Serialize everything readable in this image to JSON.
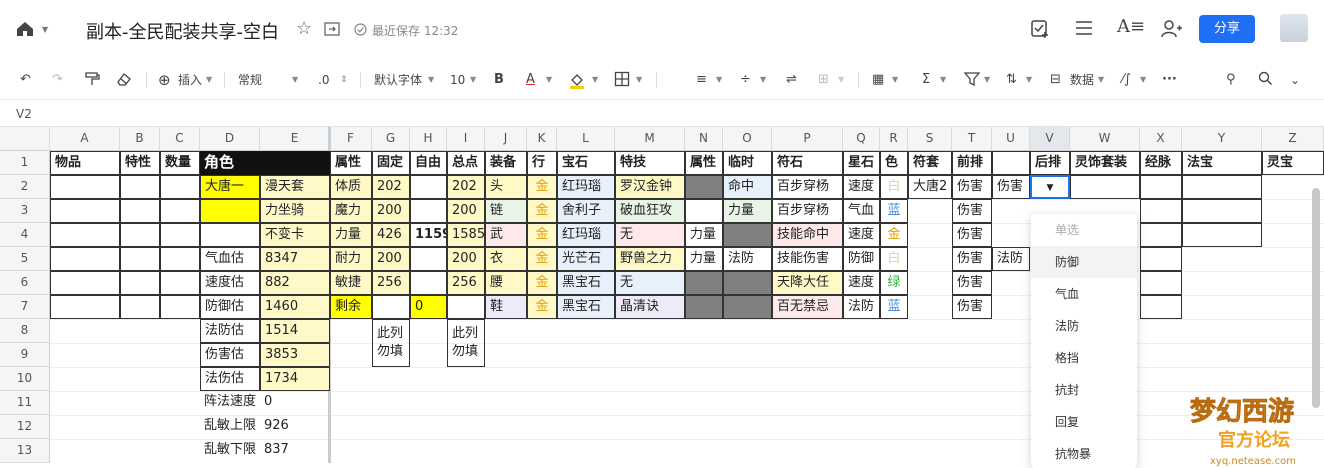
{
  "header": {
    "title": "副本-全民配装共享-空白",
    "saved_status": "最近保存 12:32",
    "share_label": "分享"
  },
  "toolbar": {
    "insert_label": "插入",
    "format_label": "常规",
    "decimal_label": ".0",
    "font_label": "默认字体",
    "size_label": "10",
    "data_label": "数据"
  },
  "name_box": "V2",
  "column_letters": [
    "A",
    "B",
    "C",
    "D",
    "E",
    "F",
    "G",
    "H",
    "I",
    "J",
    "K",
    "L",
    "M",
    "N",
    "O",
    "P",
    "Q",
    "R",
    "S",
    "T",
    "U",
    "V",
    "W",
    "X",
    "Y",
    "Z"
  ],
  "row_numbers": [
    "1",
    "2",
    "3",
    "4",
    "5",
    "6",
    "7",
    "8",
    "9",
    "10",
    "11",
    "12",
    "13"
  ],
  "headers": {
    "A": "物品",
    "B": "特性",
    "C": "数量",
    "D": "角色",
    "F": "属性",
    "G": "固定",
    "H": "自由",
    "I": "总点",
    "J": "装备",
    "K": "行",
    "L": "宝石",
    "M": "特技",
    "N": "属性",
    "O": "临时",
    "P": "符石",
    "Q": "星石",
    "R": "色",
    "S": "符套",
    "T": "前排",
    "V": "后排",
    "W": "灵饰套装",
    "X": "经脉",
    "Y": "法宝",
    "Z": "灵宝"
  },
  "cells": {
    "D2": "大唐一",
    "E2": "漫天套",
    "E3": "力坐骑",
    "E4": "不变卡",
    "D5": "气血估",
    "E5": "8347",
    "D6": "速度估",
    "E6": "882",
    "D7": "防御估",
    "E7": "1460",
    "D8": "法防估",
    "E8": "1514",
    "D9": "伤害估",
    "E9": "3853",
    "D10": "法伤估",
    "E10": "1734",
    "D11": "阵法速度",
    "E11": "0",
    "D12": "乱敏上限",
    "E12": "926",
    "D13": "乱敏下限",
    "E13": "837",
    "F2": "体质",
    "G2": "202",
    "I2": "202",
    "F3": "魔力",
    "G3": "200",
    "I3": "200",
    "F4": "力量",
    "G4": "426",
    "H4": "1159",
    "I4": "1585",
    "F5": "耐力",
    "G5": "200",
    "I5": "200",
    "F6": "敏捷",
    "G6": "256",
    "I6": "256",
    "F7": "剩余",
    "H7": "0",
    "G8": "此列\n勿填",
    "I8": "此列\n勿填",
    "J2": "头",
    "J3": "链",
    "J4": "武",
    "J5": "衣",
    "J6": "腰",
    "J7": "鞋",
    "K2": "金",
    "K3": "金",
    "K4": "金",
    "K5": "金",
    "K6": "金",
    "K7": "金",
    "L2": "红玛瑙",
    "L3": "舍利子",
    "L4": "红玛瑙",
    "L5": "光芒石",
    "L6": "黑宝石",
    "L7": "黑宝石",
    "M2": "罗汉金钟",
    "M3": "破血狂攻",
    "M4": "无",
    "M5": "野兽之力",
    "M6": "无",
    "M7": "晶清诀",
    "N4": "力量",
    "N5": "力量",
    "O2": "命中",
    "O3": "力量",
    "O5": "法防",
    "P2": "百步穿杨",
    "P3": "百步穿杨",
    "P4": "技能命中",
    "P5": "技能伤害",
    "P6": "天降大任",
    "P7": "百无禁忌",
    "Q2": "速度",
    "Q3": "气血",
    "Q4": "速度",
    "Q5": "防御",
    "Q6": "速度",
    "Q7": "法防",
    "R2": "白",
    "R3": "蓝",
    "R4": "金",
    "R5": "白",
    "R6": "绿",
    "R7": "蓝",
    "S2": "大唐2",
    "T2": "伤害",
    "U2": "伤害",
    "T3": "伤害",
    "T4": "伤害",
    "T5": "伤害",
    "U5": "法防",
    "T6": "伤害",
    "T7": "伤害"
  },
  "dropdown": {
    "title": "单选",
    "options": [
      "防御",
      "气血",
      "法防",
      "格挡",
      "抗封",
      "回复",
      "抗物暴"
    ]
  },
  "watermark": {
    "text": "梦幻西游",
    "sub": "官方论坛",
    "url": "xyq.netease.com"
  },
  "colors": {
    "accent": "#1f6ff5",
    "yellow": "#fff9c8",
    "bright_yellow": "#ffff00",
    "gray": "#808080",
    "header_black": "#111111"
  }
}
